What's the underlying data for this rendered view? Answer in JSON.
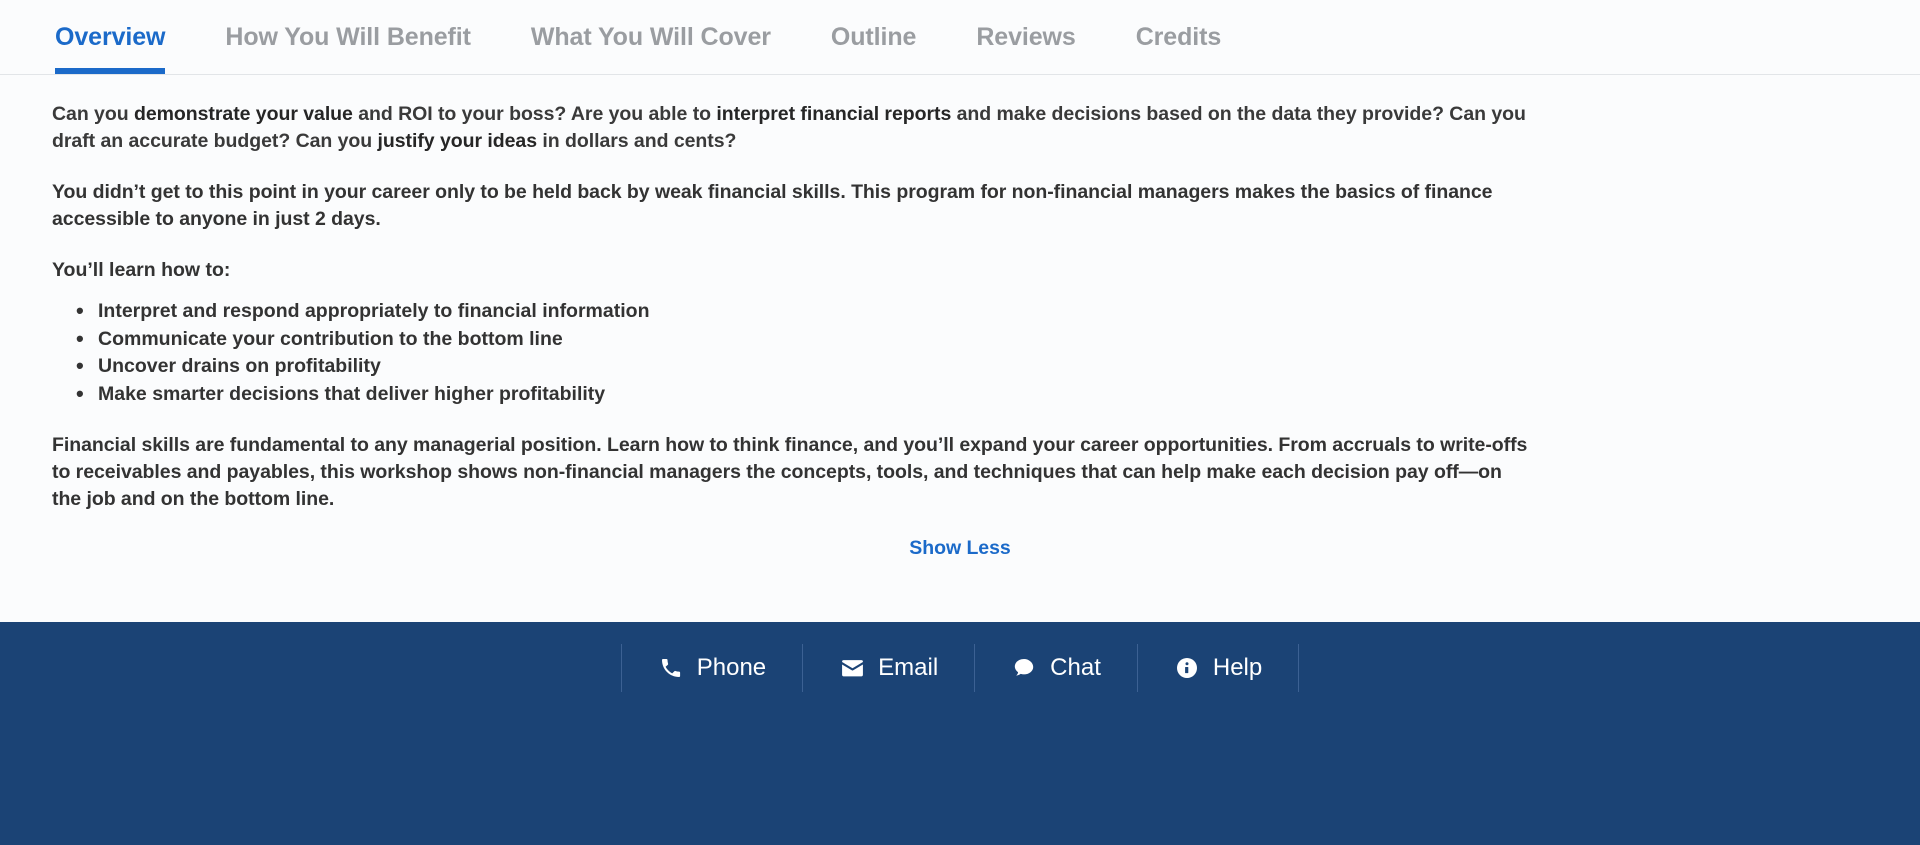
{
  "tabs": [
    {
      "label": "Overview",
      "active": true
    },
    {
      "label": "How You Will Benefit",
      "active": false
    },
    {
      "label": "What You Will Cover",
      "active": false
    },
    {
      "label": "Outline",
      "active": false
    },
    {
      "label": "Reviews",
      "active": false
    },
    {
      "label": "Credits",
      "active": false
    }
  ],
  "overview": {
    "paragraph1": {
      "s1": "Can you ",
      "b1": "demonstrate your value",
      "s2": " and ROI to your boss? Are you able to ",
      "b2": "interpret financial reports",
      "s3": " and make decisions based on the data they provide? Can you draft an accurate budget? Can you ",
      "b3": "justify your ideas",
      "s4": " in dollars and cents?"
    },
    "paragraph2": "You didn’t get to this point in your career only to be held back by weak financial skills. This program for non-financial managers makes the basics of finance accessible to anyone in just 2 days.",
    "lead_in": "You’ll learn how to:",
    "bullets": [
      "Interpret and respond appropriately to financial information",
      "Communicate your contribution to the bottom line",
      "Uncover drains on profitability",
      "Make smarter decisions that deliver higher profitability"
    ],
    "paragraph3": "Financial skills are fundamental to any managerial position. Learn how to think finance, and you’ll expand your career opportunities. From accruals to write-offs to receivables and payables, this workshop shows non-financial managers the concepts, tools, and techniques that can help make each decision pay off—on the job and on the bottom line.",
    "show_less_label": "Show Less"
  },
  "bottom_bar": {
    "items": [
      {
        "label": "Phone",
        "icon": "phone-icon"
      },
      {
        "label": "Email",
        "icon": "envelope-icon"
      },
      {
        "label": "Chat",
        "icon": "chat-bubble-icon"
      },
      {
        "label": "Help",
        "icon": "info-circle-icon"
      }
    ]
  },
  "colors": {
    "accent_blue": "#1b6ac9",
    "bar_navy": "#1b4375",
    "text_dark": "#333333",
    "tab_inactive": "#9a9da1",
    "page_bg": "#fbfcfd"
  }
}
